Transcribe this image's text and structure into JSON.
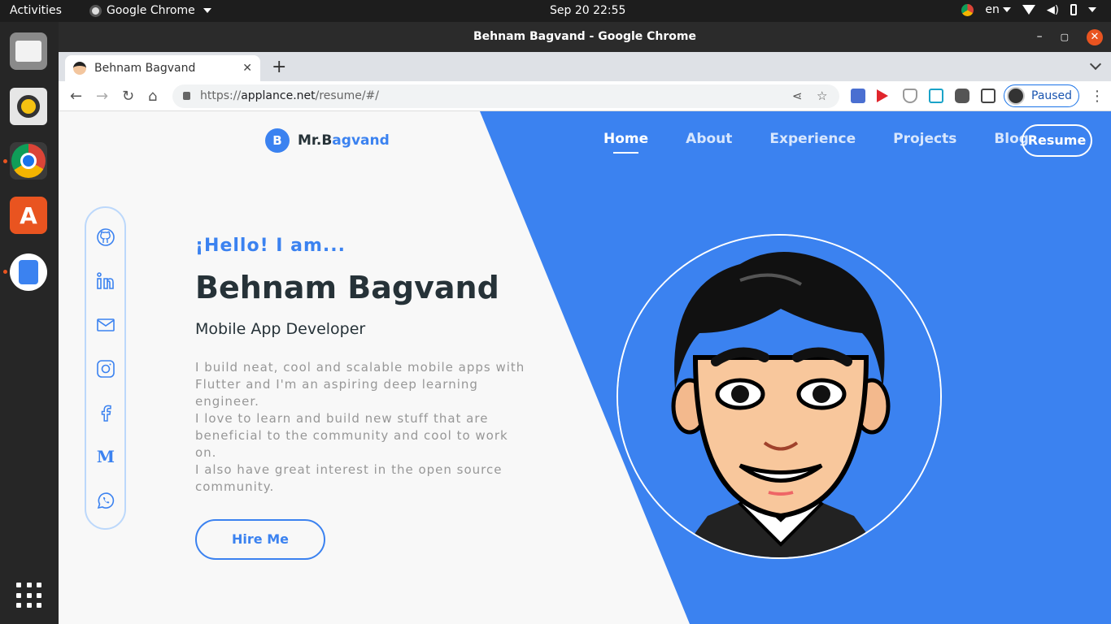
{
  "system": {
    "activities": "Activities",
    "app_name": "Google Chrome",
    "clock": "Sep 20  22:55",
    "lang": "en"
  },
  "window": {
    "title": "Behnam Bagvand - Google Chrome"
  },
  "browser": {
    "tab_title": "Behnam Bagvand",
    "url_prefix": "https://",
    "url_host": "applance.net",
    "url_path": "/resume/#/",
    "profile_label": "Paused"
  },
  "site": {
    "logo_letter": "B",
    "logo_text_1": "Mr.B",
    "logo_text_2": "agvand",
    "nav": [
      "Home",
      "About",
      "Experience",
      "Projects",
      "Blog"
    ],
    "resume_button": "Resume",
    "hello": "¡Hello! I am...",
    "name": "Behnam Bagvand",
    "role": "Mobile App Developer",
    "bio": [
      "I build neat, cool and scalable mobile apps with Flutter and I'm an aspiring deep learning engineer.",
      "I love to learn and build new stuff that are beneficial to the community and cool to work on.",
      "I also have great interest in the open source community."
    ],
    "hire_button": "Hire Me",
    "social_icons": [
      "github-icon",
      "linkedin-icon",
      "mail-icon",
      "instagram-icon",
      "facebook-icon",
      "medium-icon",
      "whatsapp-icon"
    ]
  },
  "colors": {
    "accent": "#3b82f0",
    "dark_text": "#263238",
    "muted_text": "#979797"
  }
}
